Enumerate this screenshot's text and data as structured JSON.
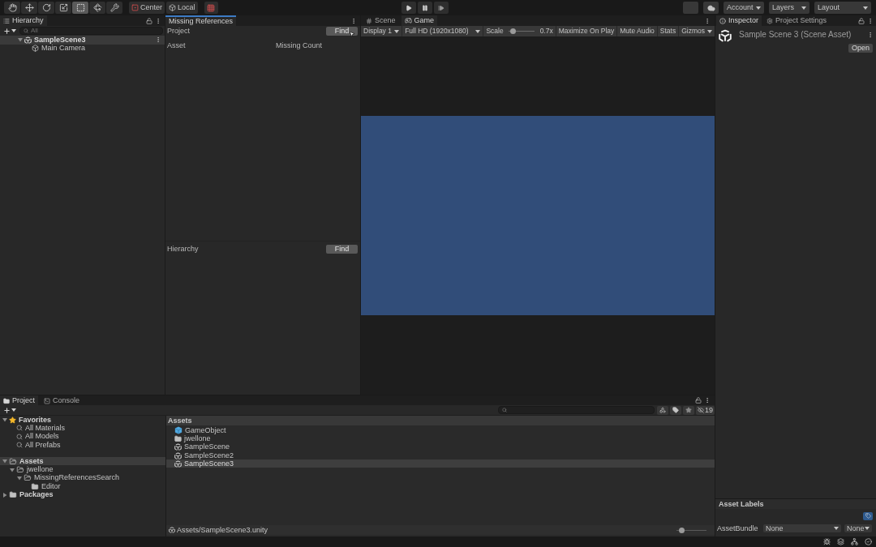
{
  "toolbar": {
    "tools": [
      {
        "kind": "hand",
        "selected": false
      },
      {
        "kind": "move",
        "selected": false
      },
      {
        "kind": "rotate",
        "selected": false
      },
      {
        "kind": "scale",
        "selected": false
      },
      {
        "kind": "rect",
        "selected": true
      },
      {
        "kind": "transform",
        "selected": false
      },
      {
        "kind": "custom",
        "selected": false
      }
    ],
    "pivot": [
      {
        "label": "Center",
        "kind": "pivot"
      },
      {
        "label": "Local",
        "kind": "space"
      }
    ],
    "menus": [
      "Account",
      "Layers",
      "Layout"
    ]
  },
  "hierarchy": {
    "tab": "Hierarchy",
    "search_placeholder": "All",
    "tree": [
      {
        "label": "SampleScene3",
        "kind": "scene",
        "expanded": true,
        "children": [
          {
            "label": "Main Camera",
            "kind": "object"
          }
        ]
      }
    ]
  },
  "missing_references": {
    "tab": "Missing References",
    "focused": true,
    "sections": [
      {
        "label": "Project",
        "button": "Find",
        "columns": [
          "Asset",
          "Missing Count"
        ]
      },
      {
        "label": "Hierarchy",
        "button": "Find"
      }
    ]
  },
  "game": {
    "tabs": [
      {
        "label": "Scene",
        "kind": "scene",
        "selected": false
      },
      {
        "label": "Game",
        "kind": "game",
        "selected": true
      }
    ],
    "display": "Display 1",
    "resolution": "Full HD (1920x1080)",
    "scale": {
      "label": "Scale",
      "level": 0.1,
      "reading": "0.7x"
    },
    "toggles": [
      {
        "label": "Maximize On Play",
        "on": false
      },
      {
        "label": "Mute Audio",
        "on": false
      },
      {
        "label": "Stats",
        "on": false
      }
    ],
    "gizmos": "Gizmos"
  },
  "inspector": {
    "tabs": [
      {
        "label": "Inspector",
        "kind": "info",
        "selected": true
      },
      {
        "label": "Project Settings",
        "kind": "settings",
        "selected": false
      }
    ],
    "title": "Sample Scene 3 (Scene Asset)",
    "open_button": "Open",
    "labels_header": "Asset Labels",
    "asset_bundle": {
      "label": "AssetBundle",
      "value": "None",
      "variant": "None"
    }
  },
  "project": {
    "tabs": [
      {
        "label": "Project",
        "kind": "folder",
        "selected": true
      },
      {
        "label": "Console",
        "kind": "console",
        "selected": false
      }
    ],
    "hidden_count": "19",
    "tree": [
      {
        "label": "Favorites",
        "kind": "favorites",
        "expanded": true,
        "selected": false,
        "children": [
          {
            "label": "All Materials",
            "kind": "search",
            "selected": false
          },
          {
            "label": "All Models",
            "kind": "search",
            "selected": false
          },
          {
            "label": "All Prefabs",
            "kind": "search",
            "selected": false
          }
        ]
      },
      {
        "label": "Assets",
        "kind": "folder",
        "expanded": true,
        "selected": true,
        "children": [
          {
            "label": "jwellone",
            "kind": "folder",
            "expanded": true,
            "selected": false,
            "children": [
              {
                "label": "MissingReferencesSearch",
                "kind": "folder",
                "expanded": true,
                "selected": false,
                "children": [
                  {
                    "label": "Editor",
                    "kind": "folder",
                    "selected": false
                  }
                ]
              }
            ]
          }
        ]
      },
      {
        "label": "Packages",
        "kind": "folder",
        "expanded": false,
        "selected": false
      }
    ],
    "breadcrumb": "Assets",
    "items": [
      {
        "label": "GameObject",
        "kind": "prefab",
        "selected": false
      },
      {
        "label": "jwellone",
        "kind": "folder",
        "selected": false
      },
      {
        "label": "SampleScene",
        "kind": "scene",
        "selected": false
      },
      {
        "label": "SampleScene2",
        "kind": "scene",
        "selected": false
      },
      {
        "label": "SampleScene3",
        "kind": "scene",
        "selected": true
      }
    ],
    "path": "Assets/SampleScene3.unity",
    "size_slider": {
      "level": 0.1
    }
  }
}
